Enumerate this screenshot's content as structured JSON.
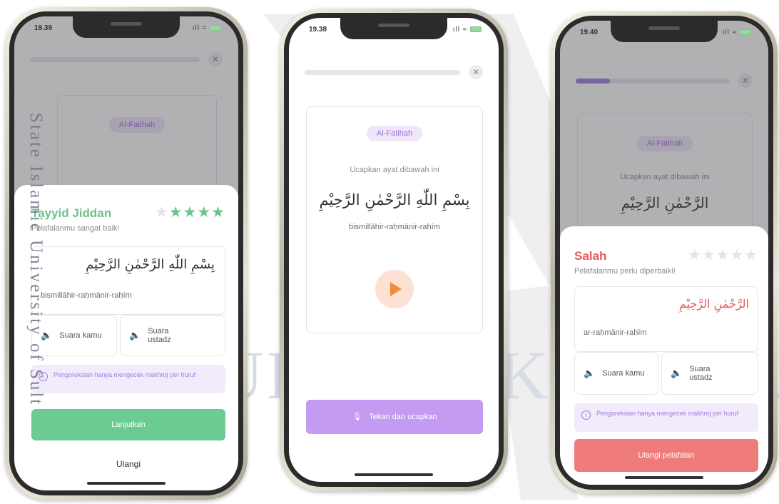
{
  "watermark": {
    "big_text": "UIN SUSKA RIAU",
    "vertical_text": "State Islamic University of Sult"
  },
  "phone1": {
    "status_time": "19.39",
    "status_icons": "ıll ≈",
    "chip": "Al-Fatihah",
    "progress_fraction": 0.0,
    "sheet": {
      "title": "Tayyid Jiddan",
      "title_color": "#6cc48a",
      "stars_filled": 4,
      "stars_total": 5,
      "subtitle": "Pelafalanmu sangat baik!",
      "arabic": "بِسْمِ اللّٰهِ الرَّحْمٰنِ الرَّحِيْمِ",
      "translit": "bismillāhir-raḥmānir-raḥīm",
      "sound_mine": "Suara kamu",
      "sound_ustadz": "Suara ustadz",
      "info": "Pengoreksian hanya mengecek makhroj per huruf",
      "primary_button": "Lanjutkan",
      "primary_color": "#6ccb91",
      "secondary_button": "Ulangi"
    }
  },
  "phone2": {
    "status_time": "19.38",
    "status_icons": "ıll ≈",
    "progress_fraction": 0.0,
    "chip": "Al-Fatihah",
    "instruction": "Ucapkan ayat dibawah ini",
    "arabic": "بِسْمِ اللّٰهِ الرَّحْمٰنِ الرَّحِيْمِ",
    "translit": "bismillāhir-raḥmānir-raḥīm",
    "record_button": "Tekan dan ucapkan",
    "record_color": "#c39bf2"
  },
  "phone3": {
    "status_time": "19.40",
    "status_icons": "ıll ≈",
    "progress_fraction": 0.22,
    "chip": "Al-Fatihah",
    "instruction": "Ucapkan ayat dibawah ini",
    "arabic_bg": "الرَّحْمٰنِ الرَّحِيْمِ",
    "sheet": {
      "title": "Salah",
      "title_color": "#e65a5a",
      "stars_filled": 0,
      "stars_total": 5,
      "subtitle": "Pelafalanmu perlu diperbaiki!",
      "arabic": "الرَّحْمٰنِ الرَّحِيْمِ",
      "arabic_color": "#e65a5a",
      "translit": "ar-raḥmānir-raḥīm",
      "sound_mine": "Suara kamu",
      "sound_ustadz": "Suara ustadz",
      "info": "Pengoreksian hanya mengecek makhroj per huruf",
      "primary_button": "Ulangi pelafalan",
      "primary_color": "#ef7b7b"
    }
  }
}
